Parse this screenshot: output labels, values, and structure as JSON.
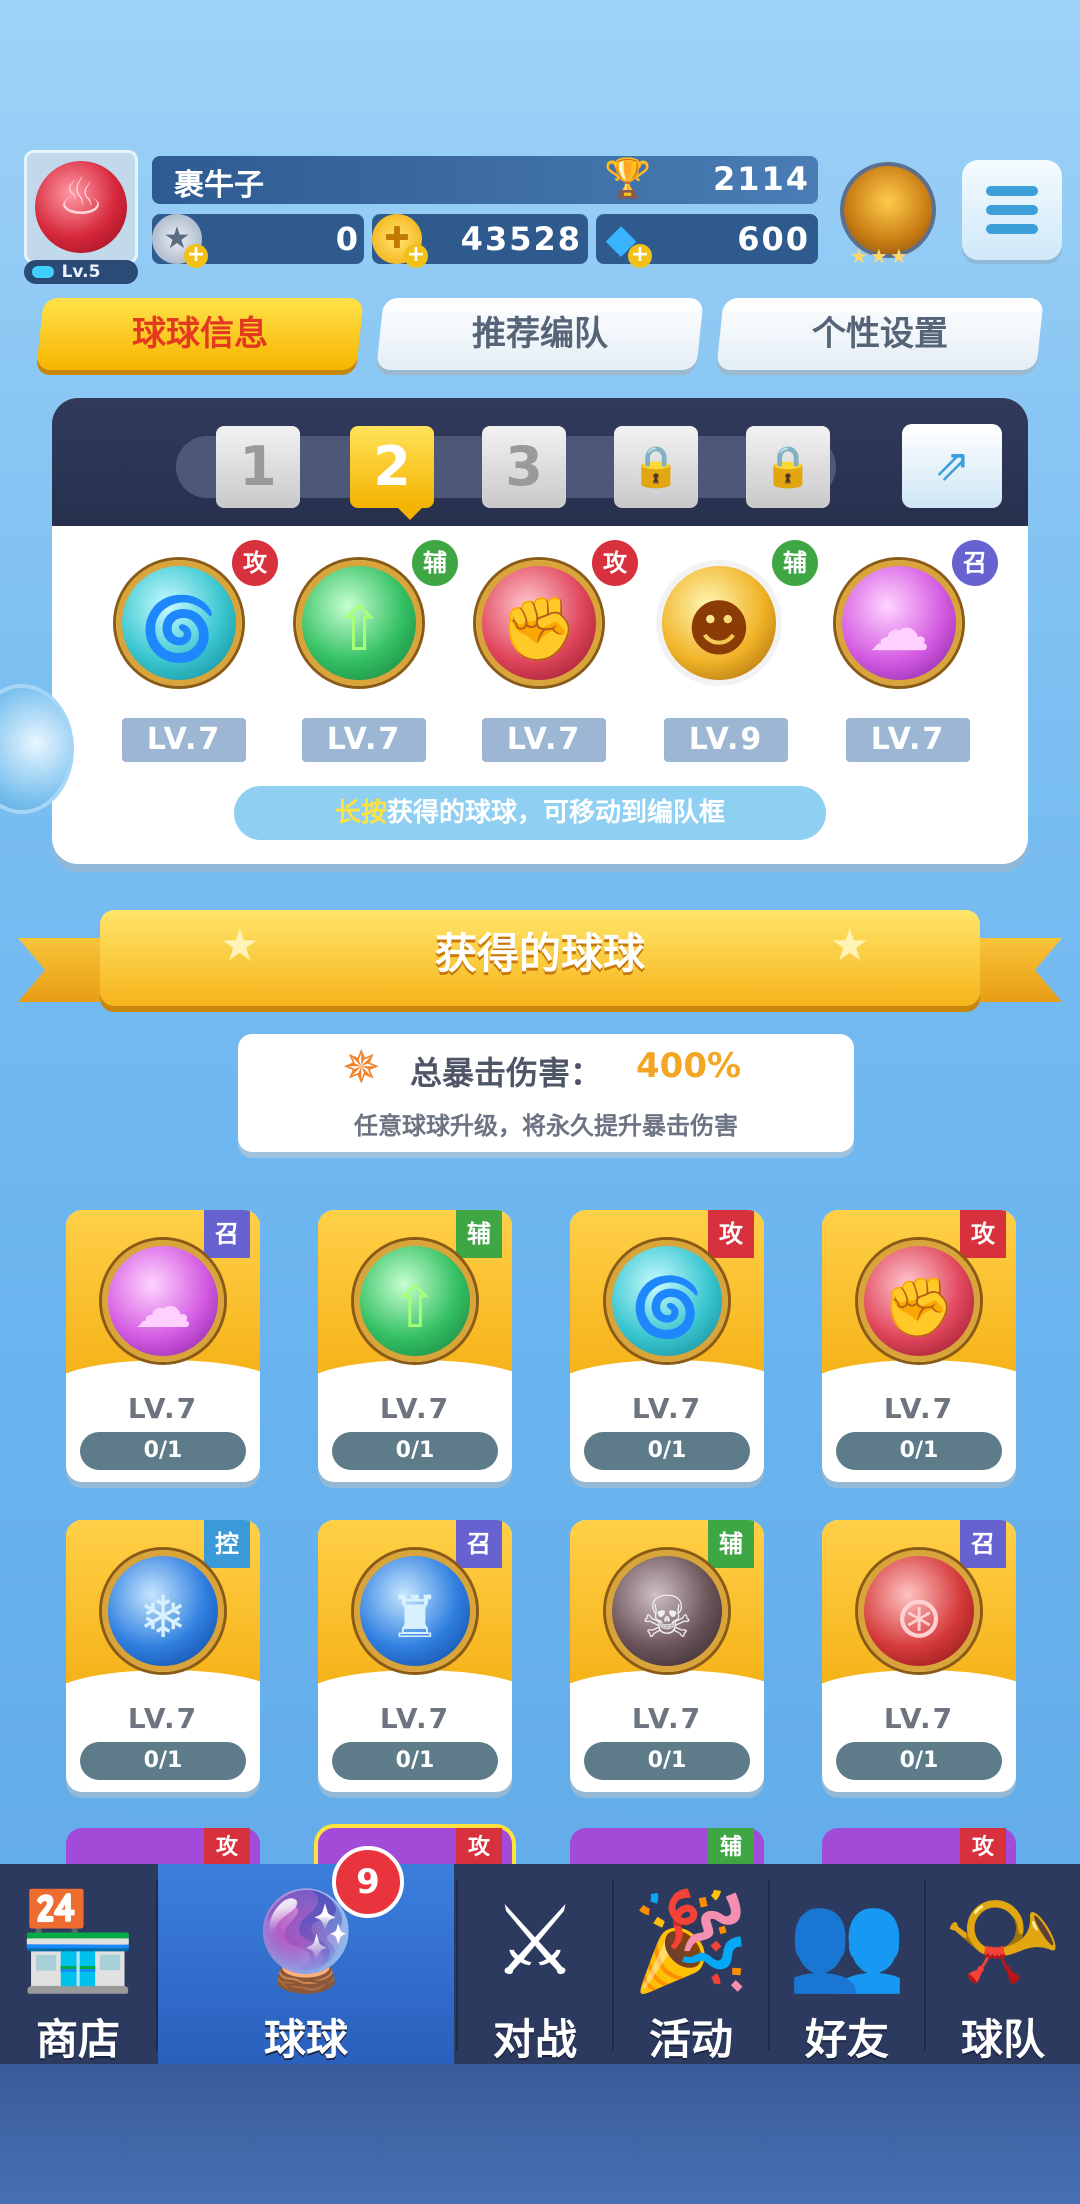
{
  "player": {
    "name": "裹牛子",
    "level": "Lv.5",
    "trophies": "2114",
    "silver": "0",
    "gold": "43528",
    "gems": "600"
  },
  "icons": {
    "avatar": "flame-ball",
    "trophy": "trophy-icon",
    "silver": "silver-coin-icon",
    "gold": "gold-coin-icon",
    "gems": "diamond-icon",
    "menu": "hamburger-menu-icon",
    "rank": "rank-badge-icon",
    "share": "share-icon",
    "lock": "lock-icon"
  },
  "tabs": [
    {
      "label": "球球信息",
      "active": true
    },
    {
      "label": "推荐编队",
      "active": false
    },
    {
      "label": "个性设置",
      "active": false
    }
  ],
  "team": {
    "slots": [
      {
        "label": "1",
        "state": "normal"
      },
      {
        "label": "2",
        "state": "active"
      },
      {
        "label": "3",
        "state": "normal"
      },
      {
        "label": "",
        "state": "locked"
      },
      {
        "label": "",
        "state": "locked"
      }
    ],
    "balls": [
      {
        "type_badge": "攻",
        "level": "LV.7",
        "icon": "tornado-icon"
      },
      {
        "type_badge": "辅",
        "level": "LV.7",
        "icon": "arrow-up-icon"
      },
      {
        "type_badge": "攻",
        "level": "LV.7",
        "icon": "fist-icon"
      },
      {
        "type_badge": "辅",
        "level": "LV.9",
        "icon": "pumpkin-face-icon"
      },
      {
        "type_badge": "召",
        "level": "LV.7",
        "icon": "mushroom-cloud-icon"
      }
    ],
    "hint_highlight": "长按",
    "hint_text": "获得的球球，可移动到编队框"
  },
  "obtained": {
    "title": "获得的球球",
    "crit_label": "总暴击伤害：",
    "crit_value": "400%",
    "crit_desc": "任意球球升级，将永久提升暴击伤害"
  },
  "cards": [
    {
      "type_badge": "召",
      "level": "LV.7",
      "progress": "0/1",
      "icon": "mushroom-cloud-icon"
    },
    {
      "type_badge": "辅",
      "level": "LV.7",
      "progress": "0/1",
      "icon": "arrow-up-icon"
    },
    {
      "type_badge": "攻",
      "level": "LV.7",
      "progress": "0/1",
      "icon": "tornado-icon"
    },
    {
      "type_badge": "攻",
      "level": "LV.7",
      "progress": "0/1",
      "icon": "fist-icon"
    },
    {
      "type_badge": "控",
      "level": "LV.7",
      "progress": "0/1",
      "icon": "snowflake-icon"
    },
    {
      "type_badge": "召",
      "level": "LV.7",
      "progress": "0/1",
      "icon": "ice-wall-icon"
    },
    {
      "type_badge": "辅",
      "level": "LV.7",
      "progress": "0/1",
      "icon": "skull-icon"
    },
    {
      "type_badge": "召",
      "level": "LV.7",
      "progress": "0/1",
      "icon": "cannon-icon"
    }
  ],
  "partial_cards": [
    {
      "type_badge": "攻"
    },
    {
      "type_badge": "攻"
    },
    {
      "type_badge": "辅"
    },
    {
      "type_badge": "攻"
    }
  ],
  "nav": {
    "items": [
      {
        "label": "商店",
        "icon": "shop-icon"
      },
      {
        "label": "球球",
        "icon": "balls-icon",
        "active": true,
        "badge": "9"
      },
      {
        "label": "对战",
        "icon": "crossed-swords-icon"
      },
      {
        "label": "活动",
        "icon": "party-popper-icon"
      },
      {
        "label": "好友",
        "icon": "friends-book-icon"
      },
      {
        "label": "球队",
        "icon": "whistle-icon"
      }
    ]
  },
  "colors": {
    "attack": "#d7313d",
    "support": "#3ea744",
    "summon": "#6662cf",
    "control": "#3a9ad8",
    "accent_yellow": "#f7b500"
  }
}
